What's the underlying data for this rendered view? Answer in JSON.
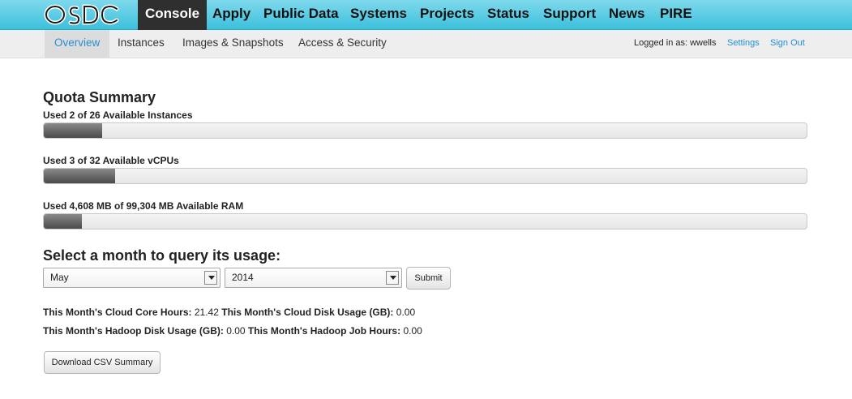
{
  "nav": {
    "logo_text": "OSDC",
    "items": [
      "Console",
      "Apply",
      "Public Data",
      "Systems",
      "Projects",
      "Status",
      "Support",
      "News",
      "PIRE"
    ],
    "active": "Console"
  },
  "subnav": {
    "tabs": [
      "Overview",
      "Instances",
      "Images & Snapshots",
      "Access & Security"
    ],
    "active": "Overview",
    "logged_in_text": "Logged in as: wwells",
    "settings": "Settings",
    "sign_out": "Sign Out"
  },
  "quota": {
    "title": "Quota Summary",
    "instances": {
      "label": "Used 2 of 26 Available Instances",
      "used": 2,
      "total": 26
    },
    "vcpus": {
      "label": "Used 3 of 32 Available vCPUs",
      "used": 3,
      "total": 32
    },
    "ram": {
      "label": "Used 4,608 MB of 99,304 MB Available RAM",
      "used": 4608,
      "total": 99304
    }
  },
  "usage_query": {
    "title": "Select a month to query its usage:",
    "month": "May",
    "year": "2014",
    "submit": "Submit"
  },
  "stats": {
    "cloud_core_hours_label": "This Month's Cloud Core Hours:",
    "cloud_core_hours": "21.42",
    "cloud_disk_label": "This Month's Cloud Disk Usage (GB):",
    "cloud_disk": "0.00",
    "hadoop_disk_label": "This Month's Hadoop Disk Usage (GB):",
    "hadoop_disk": "0.00",
    "hadoop_job_label": "This Month's Hadoop Job Hours:",
    "hadoop_job": "0.00"
  },
  "download_button": "Download CSV Summary",
  "colors": {
    "nav_bg": "#3cc0dc",
    "active_nav": "#2f2f2f",
    "link": "#1e8fd6",
    "bar_fill": "#5a5a5a"
  }
}
